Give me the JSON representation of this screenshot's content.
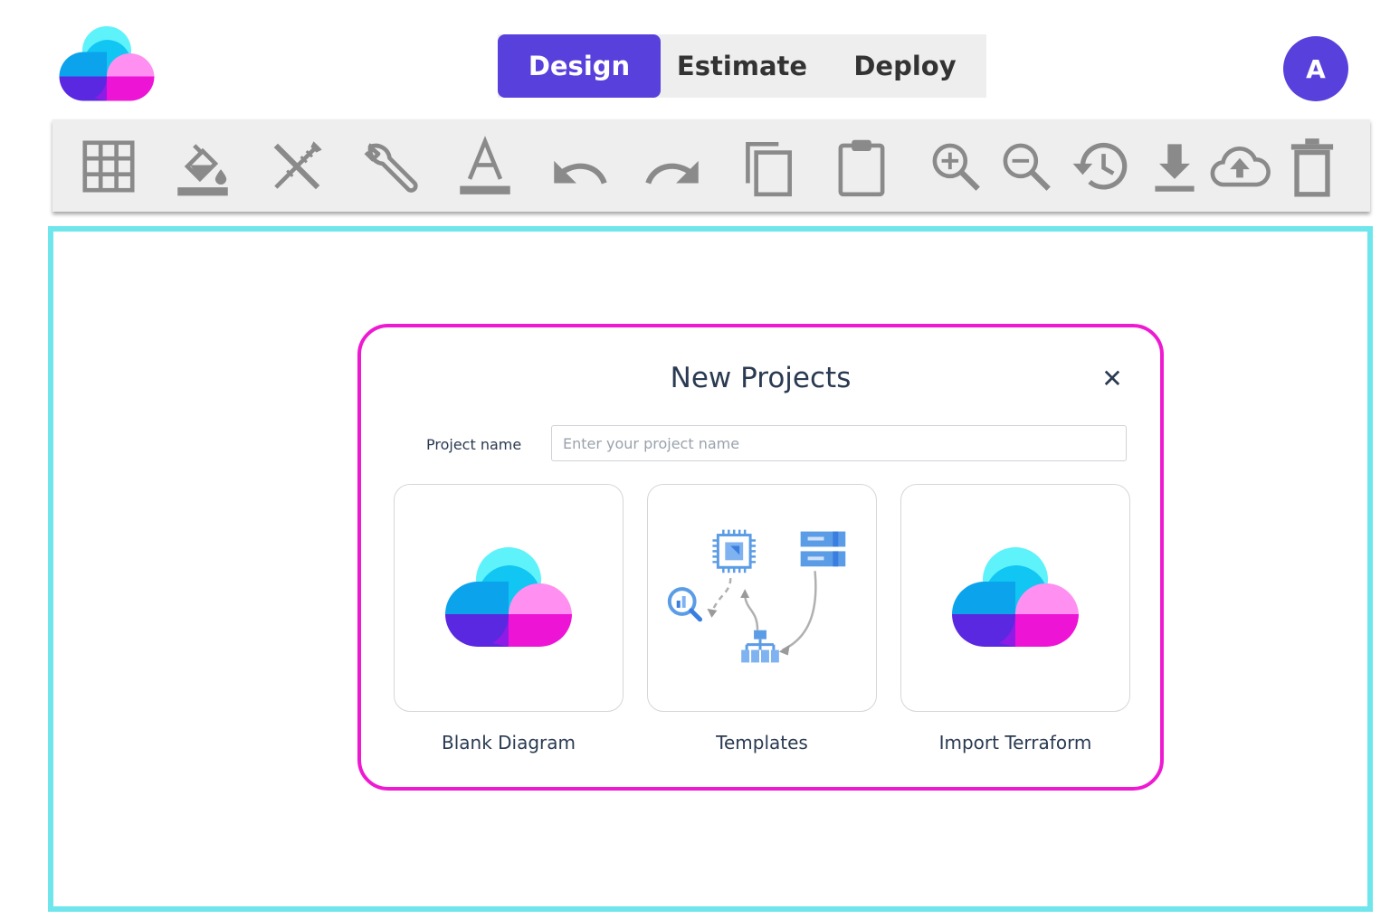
{
  "nav": {
    "tabs": [
      {
        "label": "Design",
        "active": true
      },
      {
        "label": "Estimate",
        "active": false
      },
      {
        "label": "Deploy",
        "active": false
      }
    ]
  },
  "user": {
    "avatar_initial": "A"
  },
  "toolbar": {
    "icons": [
      "grid-icon",
      "fill-color-icon",
      "tools-icon",
      "wrench-icon",
      "text-color-icon",
      "undo-icon",
      "redo-icon",
      "copy-icon",
      "paste-icon",
      "zoom-in-icon",
      "zoom-out-icon",
      "history-icon",
      "download-icon",
      "cloud-upload-icon",
      "delete-icon"
    ]
  },
  "dialog": {
    "title": "New Projects",
    "close_symbol": "✕",
    "project_name_label": "Project name",
    "project_name_placeholder": "Enter your project name",
    "project_name_value": "",
    "options": [
      {
        "label": "Blank Diagram",
        "icon": "cloud-logo-icon"
      },
      {
        "label": "Templates",
        "icon": "architecture-template-icon"
      },
      {
        "label": "Import Terraform",
        "icon": "cloud-logo-icon"
      }
    ]
  },
  "colors": {
    "accent": "#5840dc",
    "canvas_border": "#6ee6ec",
    "dialog_border": "#ee1ad2",
    "logo_cyan": "#5ef2fb",
    "logo_blue": "#0aa3ec",
    "logo_pink": "#ff8ff0",
    "logo_magenta": "#ee14d6",
    "logo_purple": "#5a28e0"
  }
}
